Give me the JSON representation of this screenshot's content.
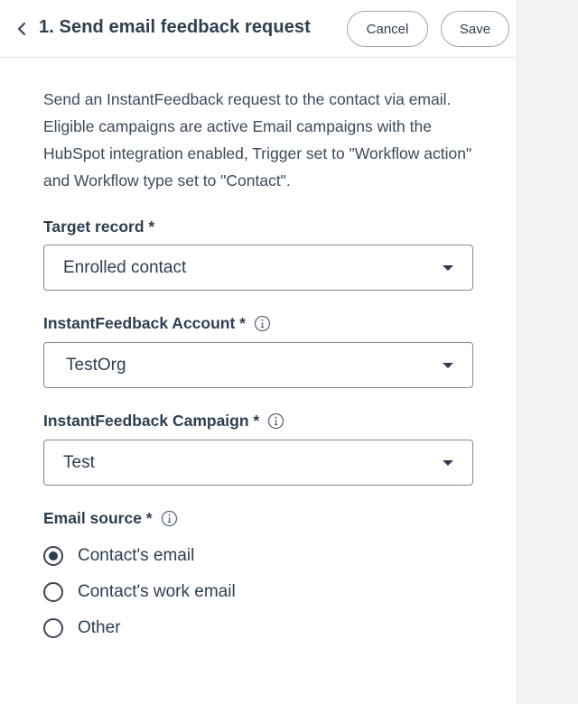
{
  "header": {
    "title": "1. Send email feedback request",
    "cancel_label": "Cancel",
    "save_label": "Save"
  },
  "description": "Send an InstantFeedback request to the contact via email. Eligible campaigns are active Email campaigns with the HubSpot integration enabled, Trigger set to \"Workflow action\" and Workflow type set to \"Contact\".",
  "fields": {
    "target_record": {
      "label": "Target record *",
      "value": "Enrolled contact"
    },
    "account": {
      "label": "InstantFeedback Account *",
      "value": "TestOrg"
    },
    "campaign": {
      "label": "InstantFeedback Campaign *",
      "value": "Test"
    },
    "email_source": {
      "label": "Email source *",
      "options": [
        {
          "label": "Contact's email",
          "selected": true
        },
        {
          "label": "Contact's work email",
          "selected": false
        },
        {
          "label": "Other",
          "selected": false
        }
      ]
    }
  },
  "colors": {
    "text": "#2d3e50",
    "border": "#7c8896",
    "gutter": "#f3f3f3"
  },
  "icons": {
    "back": "chevron-left-icon",
    "info": "info-icon",
    "dropdown": "caret-down-icon"
  }
}
